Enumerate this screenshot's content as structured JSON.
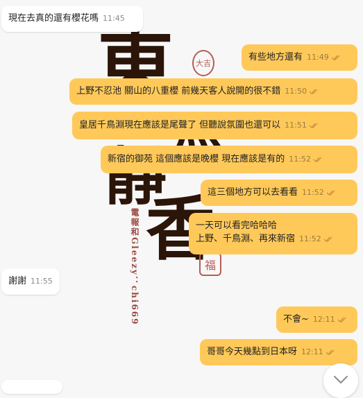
{
  "wallpaper": {
    "calligraphy": [
      "東",
      "灬",
      "靜",
      "香"
    ],
    "seal_top": "大吉",
    "seal_bottom": "福",
    "vertical_caption": "電報和Gleezy：chi669"
  },
  "messages": [
    {
      "dir": "in",
      "text": "現在去真的還有櫻花嗎",
      "time": "11:45"
    },
    {
      "dir": "out",
      "text": "有些地方還有",
      "time": "11:49"
    },
    {
      "dir": "out",
      "text": "上野不忍池 關山的八重櫻 前幾天客人說開的很不錯",
      "time": "11:50"
    },
    {
      "dir": "out",
      "text": "皇居千鳥淵現在應該是尾聲了 但聽說氛圍也還可以",
      "time": "11:51"
    },
    {
      "dir": "out",
      "text": "新宿的御苑 這個應該是晚櫻 現在應該是有的",
      "time": "11:52"
    },
    {
      "dir": "out",
      "text": "這三個地方可以去看看",
      "time": "11:52"
    },
    {
      "dir": "out",
      "text": "一天可以看完哈哈哈\n上野、千鳥淵、再來新宿",
      "time": "11:52"
    },
    {
      "dir": "in",
      "text": "謝謝",
      "time": "11:55"
    },
    {
      "dir": "out",
      "text": "不會~",
      "time": "12:11"
    },
    {
      "dir": "out",
      "text": "哥哥今天幾點到日本呀",
      "time": "12:11"
    }
  ],
  "colors": {
    "outgoing": "#ffc95a",
    "incoming": "#ffffff",
    "tick": "#c9903a"
  },
  "icons": {
    "scroll_down": "chevron-down-icon",
    "read_receipt": "double-check-icon"
  }
}
